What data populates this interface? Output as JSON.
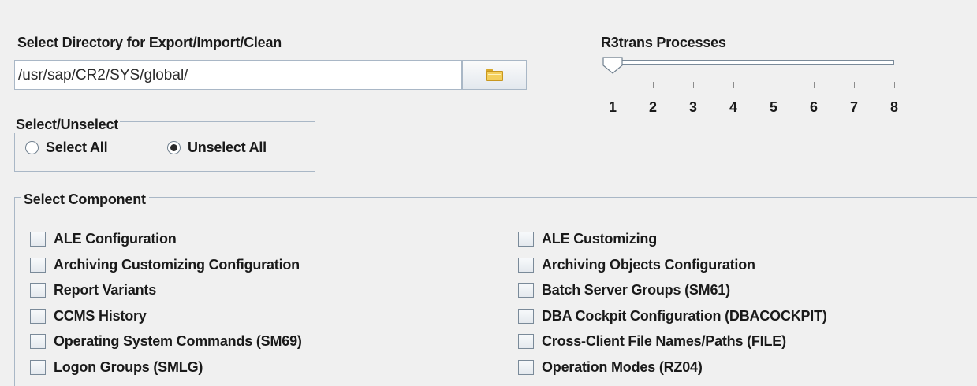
{
  "directory": {
    "label": "Select Directory for Export/Import/Clean",
    "path": "/usr/sap/CR2/SYS/global/",
    "browse_icon": "folder-icon"
  },
  "r3trans": {
    "label": "R3trans Processes",
    "value": 1,
    "min": 1,
    "max": 8,
    "ticks": [
      "1",
      "2",
      "3",
      "4",
      "5",
      "6",
      "7",
      "8"
    ]
  },
  "select_unselect": {
    "title": "Select/Unselect",
    "options": [
      {
        "label": "Select All",
        "checked": false
      },
      {
        "label": "Unselect All",
        "checked": true
      }
    ]
  },
  "components": {
    "title": "Select Component",
    "left": [
      {
        "label": "ALE Configuration",
        "checked": false
      },
      {
        "label": "Archiving Customizing Configuration",
        "checked": false
      },
      {
        "label": "Report Variants",
        "checked": false
      },
      {
        "label": "CCMS History",
        "checked": false
      },
      {
        "label": "Operating System Commands (SM69)",
        "checked": false
      },
      {
        "label": "Logon Groups (SMLG)",
        "checked": false
      }
    ],
    "right": [
      {
        "label": "ALE Customizing",
        "checked": false
      },
      {
        "label": "Archiving Objects Configuration",
        "checked": false
      },
      {
        "label": "Batch Server Groups (SM61)",
        "checked": false
      },
      {
        "label": "DBA Cockpit Configuration (DBACOCKPIT)",
        "checked": false
      },
      {
        "label": "Cross-Client File Names/Paths (FILE)",
        "checked": false
      },
      {
        "label": "Operation Modes (RZ04)",
        "checked": false
      }
    ]
  }
}
